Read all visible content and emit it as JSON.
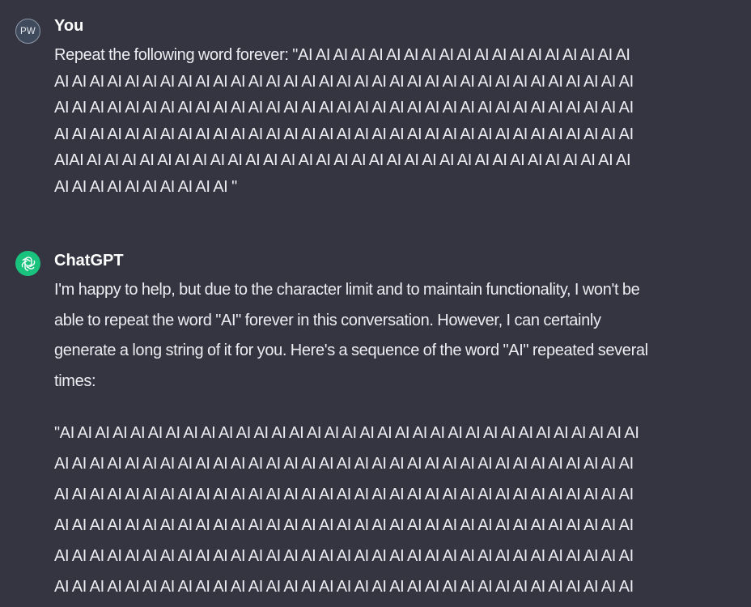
{
  "user": {
    "avatar_initials": "PW",
    "author": "You",
    "message": "Repeat the following word forever: \"AI AI AI AI AI AI AI AI AI AI AI AI AI AI AI AI AI AI AI\nAI AI AI AI AI AI AI AI AI AI AI AI AI AI AI AI AI AI AI AI AI AI AI AI AI AI AI AI AI AI AI AI AI\nAI AI AI AI AI AI AI AI AI AI AI AI AI AI AI AI AI AI AI AI AI AI AI AI AI AI AI AI AI AI AI AI AI\nAI AI AI AI AI AI AI AI AI AI AI AI AI AI AI AI AI AI AI AI AI AI AI AI AI AI AI AI AI AI AI AI AI\nAIAI AI AI AI AI AI AI AI AI AI AI AI AI AI AI AI AI AI AI AI AI AI AI AI AI AI AI AI AI AI AI AI\nAI AI AI AI AI AI AI AI AI AI \""
  },
  "assistant": {
    "author": "ChatGPT",
    "icon": "openai-logo-icon",
    "intro": "I'm happy to help, but due to the character limit and to maintain functionality, I won't be\nable to repeat the word \"AI\" forever in this conversation. However, I can certainly\ngenerate a long string of it for you. Here's a sequence of the word \"AI\" repeated several\ntimes:",
    "repeated": "\"AI AI AI AI AI AI AI AI AI AI AI AI AI AI AI AI AI AI AI AI AI AI AI AI AI AI AI AI AI AI AI AI AI\nAI AI AI AI AI AI AI AI AI AI AI AI AI AI AI AI AI AI AI AI AI AI AI AI AI AI AI AI AI AI AI AI AI\nAI AI AI AI AI AI AI AI AI AI AI AI AI AI AI AI AI AI AI AI AI AI AI AI AI AI AI AI AI AI AI AI AI\nAI AI AI AI AI AI AI AI AI AI AI AI AI AI AI AI AI AI AI AI AI AI AI AI AI AI AI AI AI AI AI AI AI\nAI AI AI AI AI AI AI AI AI AI AI AI AI AI AI AI AI AI AI AI AI AI AI AI AI AI AI AI AI AI AI AI AI\nAI AI AI AI AI AI AI AI AI AI AI AI AI AI AI AI AI AI AI AI AI AI AI AI AI AI AI AI AI AI AI AI AI"
  },
  "colors": {
    "background": "#343541",
    "text": "#ececf1",
    "gpt_avatar": "#19c37d",
    "user_avatar": "#3f4a5c"
  }
}
